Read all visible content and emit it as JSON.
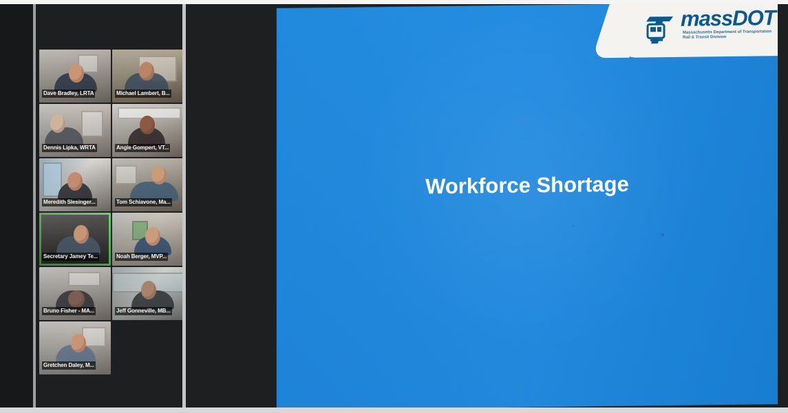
{
  "window": {
    "app": "Zoom meeting",
    "mode": "screen share with gallery sidebar"
  },
  "sidebar": {
    "active_participant_index": 6,
    "participants": [
      {
        "name": "Dave Bradley, LRTA",
        "avatar": "participant-video-thumbnail"
      },
      {
        "name": "Michael Lambert, B...",
        "avatar": "participant-video-thumbnail"
      },
      {
        "name": "Dennis Lipka, WRTA",
        "avatar": "participant-video-thumbnail"
      },
      {
        "name": "Angie Gompert, VT...",
        "avatar": "participant-video-thumbnail"
      },
      {
        "name": "Meredith Slesinger...",
        "avatar": "participant-video-thumbnail"
      },
      {
        "name": "Tom Schiavone, Ma...",
        "avatar": "participant-video-thumbnail"
      },
      {
        "name": "Secretary Jamey Te...",
        "avatar": "participant-video-thumbnail"
      },
      {
        "name": "Noah Berger, MVP...",
        "avatar": "participant-video-thumbnail"
      },
      {
        "name": "Bruno Fisher - MA...",
        "avatar": "participant-video-thumbnail"
      },
      {
        "name": "Jeff Gonneville, MB...",
        "avatar": "participant-video-thumbnail"
      },
      {
        "name": "Gretchen Daley, M...",
        "avatar": "participant-video-thumbnail"
      }
    ]
  },
  "slide": {
    "title": "Workforce Shortage",
    "background_color": "#1f88de",
    "title_color": "#ffffff",
    "logo": {
      "brand": "massDOT",
      "subtitle_1": "Massachusetts Department of Transportation",
      "subtitle_2": "Rail & Transit Division",
      "icon": "massdot-logo-icon",
      "accent_color": "#0b5a8f"
    }
  }
}
